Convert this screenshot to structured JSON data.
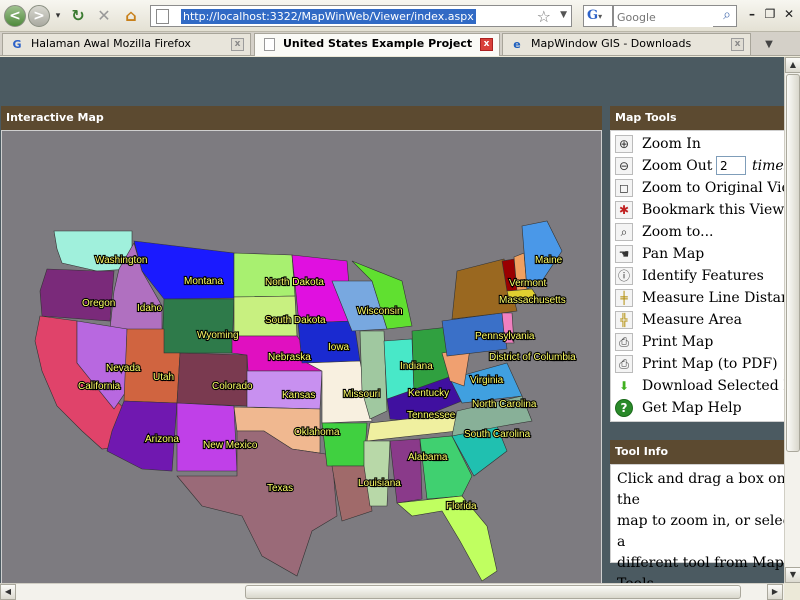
{
  "browser": {
    "url": "http://localhost:3322/MapWinWeb/Viewer/index.aspx",
    "search_placeholder": "Google",
    "search_engine_glyph": "G",
    "tabs": [
      {
        "label": "Halaman Awal Mozilla Firefox",
        "icon": "G",
        "active": false
      },
      {
        "label": "United States Example Project",
        "icon": "",
        "active": true
      },
      {
        "label": "MapWindow GIS - Downloads",
        "icon": "e",
        "active": false
      }
    ]
  },
  "map_panel": {
    "title": "Interactive Map",
    "states": {
      "washington": "Washington",
      "oregon": "Oregon",
      "california": "California",
      "idaho": "Idaho",
      "nevada": "Nevada",
      "montana": "Montana",
      "wyoming": "Wyoming",
      "utah": "Utah",
      "colorado": "Colorado",
      "arizona": "Arizona",
      "new_mexico": "New Mexico",
      "north_dakota": "North Dakota",
      "south_dakota": "South Dakota",
      "nebraska": "Nebraska",
      "kansas": "Kansas",
      "oklahoma": "Oklahoma",
      "texas": "Texas",
      "iowa": "Iowa",
      "missouri": "Missouri",
      "louisiana": "Louisiana",
      "wisconsin": "Wisconsin",
      "indiana": "Indiana",
      "kentucky": "Kentucky",
      "tennessee": "Tennessee",
      "alabama": "Alabama",
      "florida": "Florida",
      "south_carolina": "South Carolina",
      "north_carolina": "North Carolina",
      "virginia": "Virginia",
      "district_of_columbia": "District of Columbia",
      "pennsylvania": "Pennsylvania",
      "massachusetts": "Massachusetts",
      "vermont": "Vermont",
      "maine": "Maine"
    }
  },
  "tools_panel": {
    "title": "Map Tools",
    "zoom_times_value": "2",
    "zoom_times_label": "times",
    "tools": [
      {
        "label": "Zoom In",
        "icon": "magnifier-plus-icon"
      },
      {
        "label": "Zoom Out",
        "icon": "magnifier-minus-icon"
      },
      {
        "label": "Zoom to Original View",
        "icon": "zoom-extent-icon"
      },
      {
        "label": "Bookmark this View",
        "icon": "bookmark-icon"
      },
      {
        "label": "Zoom to...",
        "icon": "magnifier-icon"
      },
      {
        "label": "Pan Map",
        "icon": "hand-icon"
      },
      {
        "label": "Identify Features",
        "icon": "identify-icon"
      },
      {
        "label": "Measure Line Distance",
        "icon": "ruler-line-icon"
      },
      {
        "label": "Measure Area",
        "icon": "ruler-area-icon"
      },
      {
        "label": "Print Map",
        "icon": "printer-icon"
      },
      {
        "label": "Print Map (to PDF)",
        "icon": "printer-pdf-icon"
      },
      {
        "label": "Download Selected Layer",
        "icon": "download-arrow-icon"
      },
      {
        "label": "Get Map Help",
        "icon": "help-icon"
      }
    ]
  },
  "info_panel": {
    "title": "Tool Info",
    "lines": [
      "Click and drag a box on the",
      "map to zoom in, or select a",
      "different tool from Map Tools."
    ]
  },
  "colors": {
    "page_background": "#4b5a61",
    "panel_header": "#5c4a30",
    "map_background": "#7d7b80",
    "label_fill": "#ffff66"
  }
}
